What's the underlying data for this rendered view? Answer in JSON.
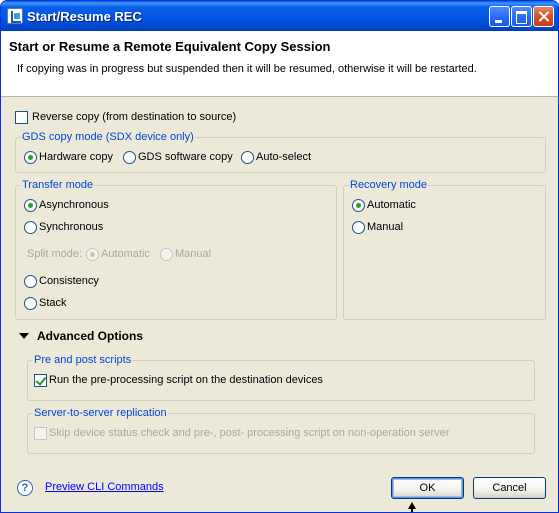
{
  "window": {
    "title": "Start/Resume REC"
  },
  "header": {
    "title": "Start or Resume a Remote Equivalent Copy Session",
    "description": "If copying was in progress but suspended then it will be resumed, otherwise it will be restarted."
  },
  "reverse_copy": {
    "label": "Reverse copy (from destination to source)",
    "checked": false
  },
  "gds_copy_mode": {
    "title": "GDS copy mode (SDX device only)",
    "options": [
      {
        "label": "Hardware copy",
        "selected": true
      },
      {
        "label": "GDS software copy",
        "selected": false
      },
      {
        "label": "Auto-select",
        "selected": false
      }
    ]
  },
  "transfer_mode": {
    "title": "Transfer mode",
    "options": [
      {
        "label": "Asynchronous",
        "selected": true
      },
      {
        "label": "Synchronous",
        "selected": false
      },
      {
        "label": "Consistency",
        "selected": false
      },
      {
        "label": "Stack",
        "selected": false
      }
    ],
    "split_mode": {
      "label": "Split mode:",
      "options": [
        {
          "label": "Automatic",
          "selected": true,
          "enabled": false
        },
        {
          "label": "Manual",
          "selected": false,
          "enabled": false
        }
      ]
    }
  },
  "recovery_mode": {
    "title": "Recovery mode",
    "options": [
      {
        "label": "Automatic",
        "selected": true
      },
      {
        "label": "Manual",
        "selected": false
      }
    ]
  },
  "advanced": {
    "label": "Advanced Options",
    "expanded": true,
    "pre_post": {
      "title": "Pre and post scripts",
      "checkbox_label": "Run the pre-processing script on the destination devices",
      "checked": true
    },
    "server_replication": {
      "title": "Server-to-server replication",
      "checkbox_label": "Skip device status check and pre-, post- processing script on non-operation server",
      "checked": false,
      "enabled": false
    }
  },
  "footer": {
    "help_symbol": "?",
    "preview_link": "Preview CLI Commands",
    "ok_label": "OK",
    "cancel_label": "Cancel"
  }
}
